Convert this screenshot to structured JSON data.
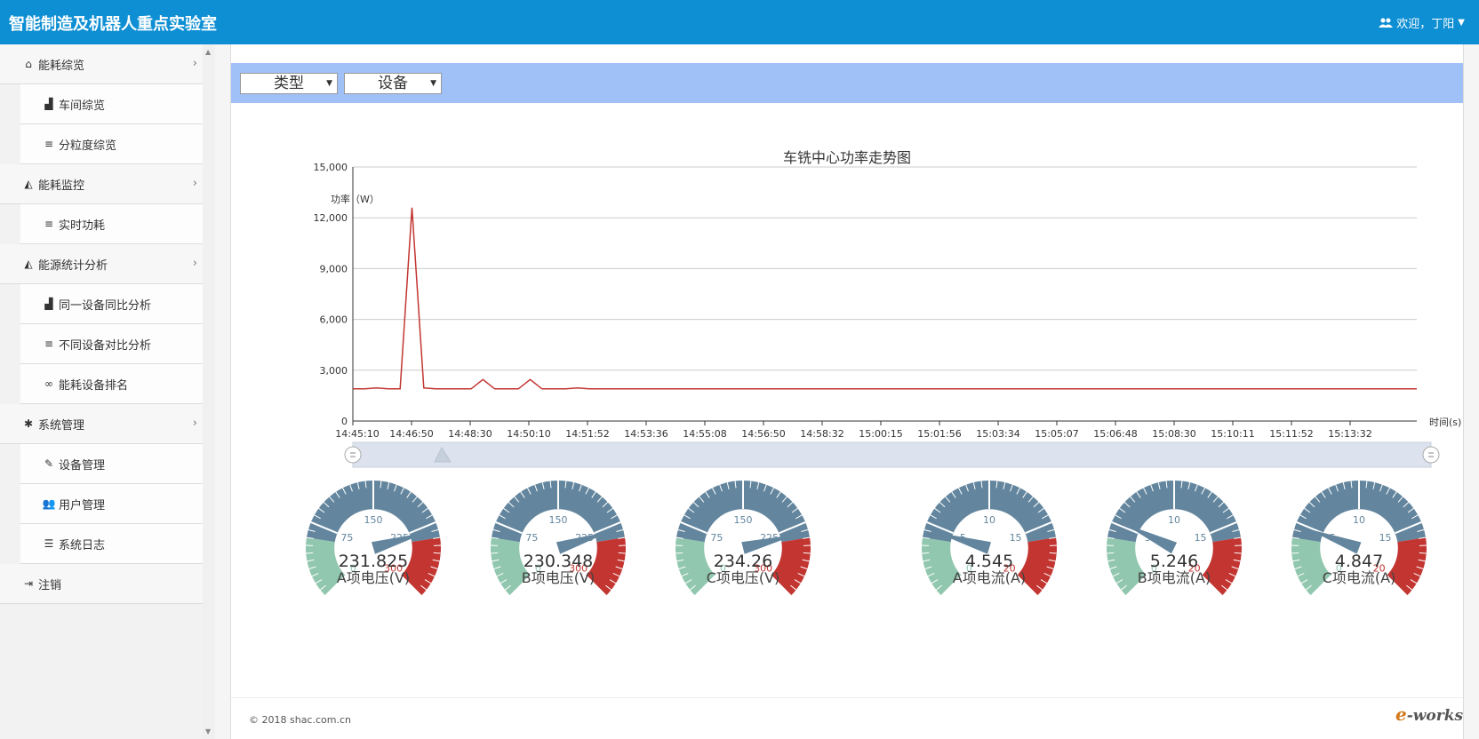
{
  "header": {
    "brand": "智能制造及机器人重点实验室",
    "user_label": "欢迎，丁阳"
  },
  "sidebar": {
    "items": [
      {
        "label": "能耗综览",
        "icon": "home-icon",
        "level": "top"
      },
      {
        "label": "车间综览",
        "icon": "factory-icon",
        "level": "sub"
      },
      {
        "label": "分粒度综览",
        "icon": "list-icon",
        "level": "sub"
      },
      {
        "label": "能耗监控",
        "icon": "area-chart-icon",
        "level": "top"
      },
      {
        "label": "实时功耗",
        "icon": "list-icon",
        "level": "sub"
      },
      {
        "label": "能源统计分析",
        "icon": "area-chart-icon",
        "level": "top"
      },
      {
        "label": "同一设备同比分析",
        "icon": "factory-icon",
        "level": "sub"
      },
      {
        "label": "不同设备对比分析",
        "icon": "list-icon",
        "level": "sub"
      },
      {
        "label": "能耗设备排名",
        "icon": "link-icon",
        "level": "sub"
      },
      {
        "label": "系统管理",
        "icon": "gear-icon",
        "level": "top"
      },
      {
        "label": "设备管理",
        "icon": "wrench-icon",
        "level": "sub"
      },
      {
        "label": "用户管理",
        "icon": "users-icon",
        "level": "sub"
      },
      {
        "label": "系统日志",
        "icon": "list-ordered-icon",
        "level": "sub"
      },
      {
        "label": "注销",
        "icon": "sign-out-icon",
        "level": "top"
      }
    ]
  },
  "filters": {
    "type_label": "类型",
    "device_label": "设备"
  },
  "footer": {
    "copyright": "© 2018 shac.com.cn"
  },
  "watermark": {
    "text_e": "e",
    "text_works": "-works"
  },
  "colors": {
    "header_bg": "#0e8fd3",
    "filter_bar": "#a0c0f8",
    "line": "#c23531",
    "gauge_low": "#91c7ae",
    "gauge_mid": "#63869e",
    "gauge_high": "#c23531"
  },
  "chart_data": [
    {
      "type": "line",
      "title": "车铣中心功率走势图",
      "ylabel": "功率（W）",
      "xlabel": "时间(s)",
      "ylim": [
        0,
        15000
      ],
      "yticks": [
        "0",
        "3,000",
        "6,000",
        "9,000",
        "12,000",
        "15,000"
      ],
      "ytick_values": [
        0,
        3000,
        6000,
        9000,
        12000,
        15000
      ],
      "xticks": [
        "14:45:10",
        "14:46:50",
        "14:48:30",
        "14:50:10",
        "14:51:52",
        "14:53:36",
        "14:55:08",
        "14:56:50",
        "14:58:32",
        "15:00:15",
        "15:01:56",
        "15:03:34",
        "15:05:07",
        "15:06:48",
        "15:08:30",
        "15:10:11",
        "15:11:52",
        "15:13:32"
      ],
      "grid": true,
      "series": [
        {
          "values": [
            1900,
            1900,
            1950,
            1900,
            1900,
            12600,
            1950,
            1900,
            1900,
            1900,
            1900,
            2450,
            1900,
            1900,
            1900,
            2450,
            1900,
            1900,
            1900,
            1950,
            1900,
            1900,
            1900,
            1900,
            1900,
            1900,
            1900,
            1900,
            1900,
            1900,
            1900,
            1900,
            1900,
            1900,
            1900,
            1900,
            1900,
            1900,
            1900,
            1900,
            1900,
            1900,
            1900,
            1900,
            1900,
            1900,
            1900,
            1900,
            1900,
            1900,
            1900,
            1900,
            1900,
            1900,
            1900,
            1900,
            1900,
            1900,
            1900,
            1900,
            1900,
            1900,
            1900,
            1900,
            1900,
            1900,
            1900,
            1900,
            1900,
            1900,
            1900,
            1900,
            1900,
            1900,
            1900,
            1900,
            1900,
            1900,
            1900,
            1900,
            1900,
            1900,
            1900,
            1900,
            1900,
            1900,
            1900,
            1900,
            1900,
            1900,
            1900
          ]
        }
      ],
      "datazoom": {
        "start": 0,
        "end": 1
      }
    },
    {
      "type": "gauge",
      "gauges": [
        {
          "name": "A项电压(V)",
          "value": 231.825,
          "display": "231.825",
          "min": 0,
          "max": 300,
          "labels": [
            "0",
            "75",
            "150",
            "225",
            "300"
          ]
        },
        {
          "name": "B项电压(V)",
          "value": 230.348,
          "display": "230.348",
          "min": 0,
          "max": 300,
          "labels": [
            "0",
            "75",
            "150",
            "225",
            "300"
          ]
        },
        {
          "name": "C项电压(V)",
          "value": 234.26,
          "display": "234.26",
          "min": 0,
          "max": 300,
          "labels": [
            "0",
            "75",
            "150",
            "225",
            "300"
          ]
        },
        {
          "name": "A项电流(A)",
          "value": 4.545,
          "display": "4.545",
          "min": 0,
          "max": 20,
          "labels": [
            "0",
            "5",
            "10",
            "15",
            "20"
          ]
        },
        {
          "name": "B项电流(A)",
          "value": 5.246,
          "display": "5.246",
          "min": 0,
          "max": 20,
          "labels": [
            "0",
            "5",
            "10",
            "15",
            "20"
          ]
        },
        {
          "name": "C项电流(A)",
          "value": 4.847,
          "display": "4.847",
          "min": 0,
          "max": 20,
          "labels": [
            "0",
            "5",
            "10",
            "15",
            "20"
          ]
        }
      ]
    }
  ]
}
